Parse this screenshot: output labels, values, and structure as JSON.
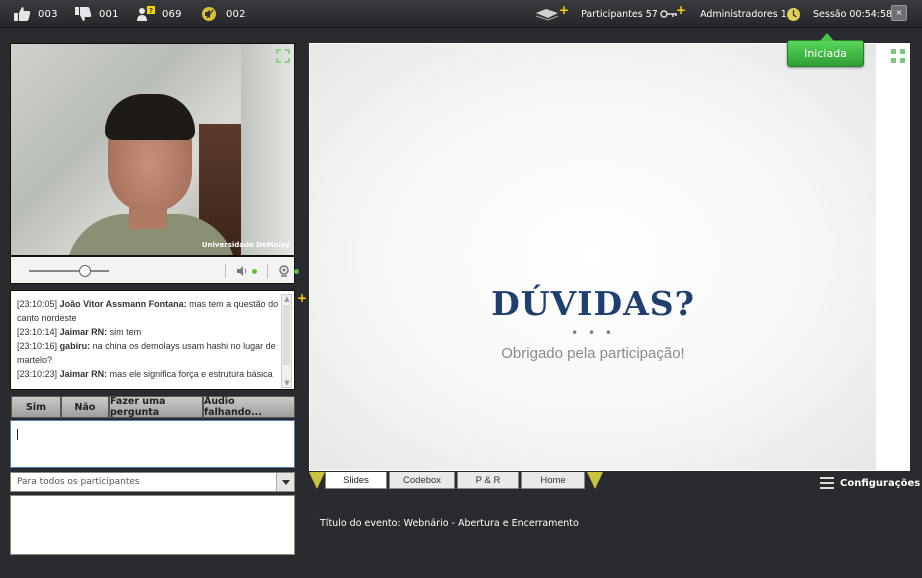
{
  "topbar": {
    "likes": "003",
    "dislikes": "001",
    "questions": "069",
    "alerts": "002",
    "participants": "Participantes 57",
    "administrators": "Administradores 1",
    "session": "Sessão 00:54:58",
    "close": "×"
  },
  "video": {
    "caption": "Universidade DeMolay"
  },
  "chat": {
    "messages": [
      {
        "time": "[23:10:05]",
        "author": "João Vitor Assmann Fontana:",
        "text": " mas tem a questão do canto nordeste"
      },
      {
        "time": "[23:10:14]",
        "author": "Jaimar RN:",
        "text": " sim tem"
      },
      {
        "time": "[23:10:16]",
        "author": "gabiru:",
        "text": " na china os demolays usam hashi no lugar de martelo?"
      },
      {
        "time": "[23:10:23]",
        "author": "Jaimar RN:",
        "text": " mas ele significa força e estrutura básica"
      }
    ],
    "quick_buttons": [
      "Sim",
      "Não",
      "Fazer uma pergunta",
      "Áudio falhando..."
    ],
    "recipient": "Para todos os participantes"
  },
  "slide": {
    "status": "Iniciada",
    "title": "DÚVIDAS?",
    "dots": "• • •",
    "subtitle": "Obrigado pela participação!"
  },
  "tabs": [
    "Slides",
    "Codebox",
    "P & R",
    "Home"
  ],
  "config_label": "Configurações",
  "event_title": "Título do evento: Webnário - Abertura e Encerramento",
  "colors": {
    "background": "#2a2b2e",
    "status_green": "#3cb83f",
    "slide_title": "#1f3f6e",
    "accent_yellow": "#ffd500"
  }
}
